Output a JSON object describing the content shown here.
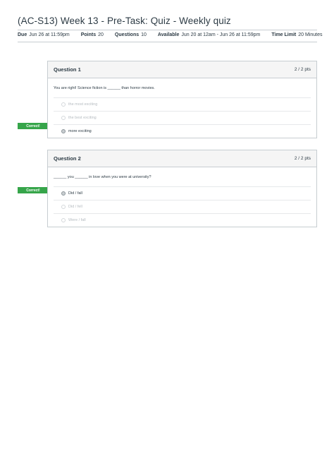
{
  "page": {
    "title": "(AC-S13) Week 13 - Pre-Task: Quiz - Weekly quiz"
  },
  "meta": {
    "due_label": "Due",
    "due_value": "Jun 26 at 11:59pm",
    "points_label": "Points",
    "points_value": "20",
    "questions_label": "Questions",
    "questions_value": "10",
    "available_label": "Available",
    "available_value": "Jun 20 at 12am - Jun 26 at 11:59pm",
    "time_limit_label": "Time Limit",
    "time_limit_value": "20 Minutes"
  },
  "questions": [
    {
      "name": "Question 1",
      "points": "2 / 2 pts",
      "badge": "Correct!",
      "text": "You are right! Science fiction is ______ than horror movies.",
      "answers": [
        "the most exciting",
        "the best exciting",
        "more exciting"
      ]
    },
    {
      "name": "Question 2",
      "points": "2 / 2 pts",
      "badge": "Correct!",
      "text": "______ you ______ in love when you were at university?",
      "answers": [
        "Did / fall",
        "Did / fell",
        "Were / fall"
      ]
    }
  ],
  "colors": {
    "correct_badge": "#36a54a",
    "border": "#c7cdd1",
    "header_bg": "#f5f5f5"
  }
}
